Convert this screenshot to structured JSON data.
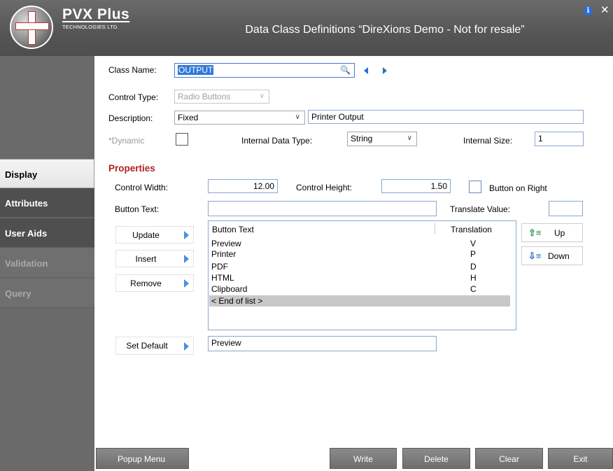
{
  "header": {
    "logo_text": "PVX Plus",
    "logo_sub": "TECHNOLOGIES LTD.",
    "title": "Data Class Definitions “DireXions Demo - Not for resale”",
    "info_icon": "i",
    "close_icon": "✕"
  },
  "sidebar": {
    "items": [
      {
        "label": "Display",
        "state": "active"
      },
      {
        "label": "Attributes",
        "state": "normal"
      },
      {
        "label": "User Aids",
        "state": "normal"
      },
      {
        "label": "Validation",
        "state": "disabled"
      },
      {
        "label": "Query",
        "state": "disabled"
      }
    ]
  },
  "form": {
    "class_name_label": "Class Name:",
    "class_name_value": "OUTPUT",
    "control_type_label": "Control Type:",
    "control_type_value": "Radio Buttons",
    "description_label": "Description:",
    "description_mode": "Fixed",
    "description_value": "Printer Output",
    "dynamic_label": "*Dynamic",
    "internal_type_label": "Internal Data Type:",
    "internal_type_value": "String",
    "internal_size_label": "Internal Size:",
    "internal_size_value": "1"
  },
  "properties": {
    "heading": "Properties",
    "width_label": "Control Width:",
    "width_value": "12.00",
    "height_label": "Control Height:",
    "height_value": "1.50",
    "button_right_label": "Button on Right",
    "button_text_label": "Button Text:",
    "button_text_value": "",
    "translate_label": "Translate Value:",
    "translate_value": "",
    "update_label": "Update",
    "insert_label": "Insert",
    "remove_label": "Remove",
    "set_default_label": "Set Default",
    "default_value": "Preview",
    "up_label": "Up",
    "down_label": "Down"
  },
  "list": {
    "col_text": "Button Text",
    "col_translation": "Translation",
    "rows": [
      {
        "text": "Preview",
        "value": "V"
      },
      {
        "text": "Printer",
        "value": "P"
      },
      {
        "text": "PDF",
        "value": "D"
      },
      {
        "text": "HTML",
        "value": "H"
      },
      {
        "text": "Clipboard",
        "value": "C"
      },
      {
        "text": "< End of list >",
        "value": ""
      }
    ]
  },
  "footer": {
    "popup": "Popup Menu",
    "write": "Write",
    "delete": "Delete",
    "clear": "Clear",
    "exit": "Exit"
  },
  "colors": {
    "accent": "#2e6fcf",
    "heading": "#b22222",
    "header_bg": "#555555",
    "sidebar_bg": "#6a6a6a"
  }
}
